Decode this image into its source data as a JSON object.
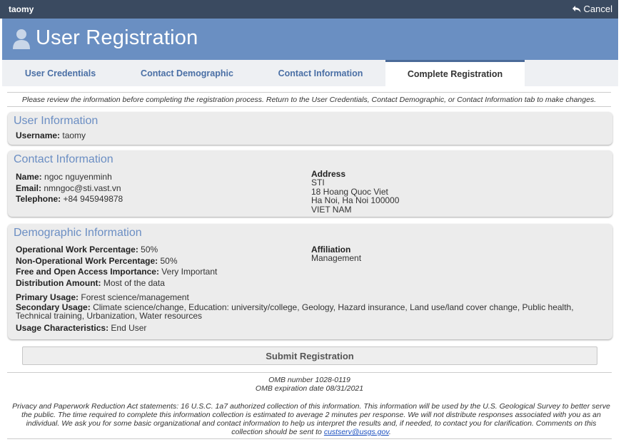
{
  "topbar": {
    "username": "taomy",
    "cancel_label": "Cancel"
  },
  "header": {
    "title": "User Registration"
  },
  "tabs": [
    {
      "label": "User Credentials"
    },
    {
      "label": "Contact Demographic"
    },
    {
      "label": "Contact Information"
    },
    {
      "label": "Complete Registration"
    }
  ],
  "instructions": "Please review the information before completing the registration process. Return to the User Credentials, Contact Demographic, or Contact Information tab to make changes.",
  "user_info": {
    "title": "User Information",
    "username_label": "Username:",
    "username_value": "taomy"
  },
  "contact_info": {
    "title": "Contact Information",
    "name_label": "Name:",
    "name_value": "ngoc nguyenminh",
    "email_label": "Email:",
    "email_value": "nmngoc@sti.vast.vn",
    "telephone_label": "Telephone:",
    "telephone_value": "+84 945949878",
    "address_label": "Address",
    "address_lines": [
      "STI",
      "18 Hoang Quoc Viet",
      "Ha Noi, Ha Noi 100000",
      "VIET NAM"
    ]
  },
  "demographic_info": {
    "title": "Demographic Information",
    "operational_label": "Operational Work Percentage:",
    "operational_value": "50%",
    "non_operational_label": "Non-Operational Work Percentage:",
    "non_operational_value": "50%",
    "foa_label": "Free and Open Access Importance:",
    "foa_value": "Very Important",
    "distribution_label": "Distribution Amount:",
    "distribution_value": "Most of the data",
    "affiliation_label": "Affiliation",
    "affiliation_value": "Management",
    "primary_label": "Primary Usage:",
    "primary_value": "Forest science/management",
    "secondary_label": "Secondary Usage:",
    "secondary_value": "Climate science/change, Education: university/college, Geology, Hazard insurance, Land use/land cover change, Public health, Technical training, Urbanization, Water resources",
    "characteristics_label": "Usage Characteristics:",
    "characteristics_value": "End User"
  },
  "submit_label": "Submit Registration",
  "omb": {
    "number": "OMB number 1028-0119",
    "expiration": "OMB expiration date 08/31/2021"
  },
  "privacy": {
    "text": "Privacy and Paperwork Reduction Act statements: 16 U.S.C. 1a7 authorized collection of this information. This information will be used by the U.S. Geological Survey to better serve the public. The time required to complete this information collection is estimated to average 2 minutes per response. We will not distribute responses associated with you as an individual. We ask you for some basic organizational and contact information to help us interpret the results and, if needed, to contact you for clarification. Comments on this collection should be sent to",
    "email": "custserv@usgs.gov",
    "end": "."
  },
  "colors": {
    "topbar": "#3a4a60",
    "header": "#6a8fc2",
    "tab_text": "#4a6fa5",
    "panel_title": "#6b8ec3"
  }
}
